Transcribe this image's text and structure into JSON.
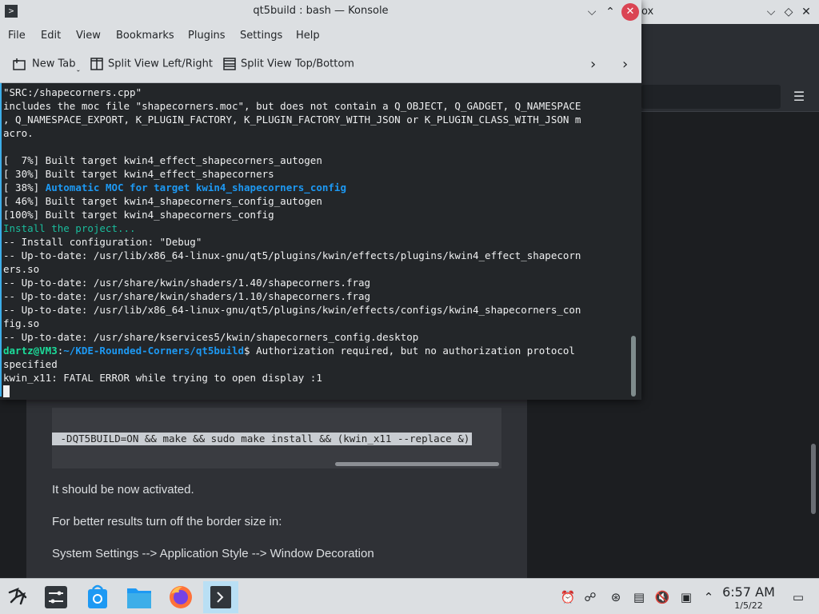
{
  "background_window": {
    "title_fragment": "ox",
    "code_line": " -DQT5BUILD=ON && make && sudo make install && (kwin_x11 --replace &)",
    "paragraphs": [
      "It should be now activated.",
      "For better results turn off the border size in:",
      "System Settings --> Application Style --> Window Decoration"
    ]
  },
  "konsole": {
    "title": "qt5build : bash — Konsole",
    "menu": [
      "File",
      "Edit",
      "View",
      "Bookmarks",
      "Plugins",
      "Settings",
      "Help"
    ],
    "toolbar": {
      "new_tab": "New Tab",
      "split_lr": "Split View Left/Right",
      "split_tb": "Split View Top/Bottom"
    },
    "terminal": {
      "l1": "\"SRC:/shapecorners.cpp\"",
      "l2": "includes the moc file \"shapecorners.moc\", but does not contain a Q_OBJECT, Q_GADGET, Q_NAMESPACE",
      "l3": ", Q_NAMESPACE_EXPORT, K_PLUGIN_FACTORY, K_PLUGIN_FACTORY_WITH_JSON or K_PLUGIN_CLASS_WITH_JSON m",
      "l4": "acro.",
      "l5": "",
      "l6": "[  7%] Built target kwin4_effect_shapecorners_autogen",
      "l7": "[ 30%] Built target kwin4_effect_shapecorners",
      "l8_prefix": "[ 38%] ",
      "l8_colored": "Automatic MOC for target kwin4_shapecorners_config",
      "l9": "[ 46%] Built target kwin4_shapecorners_config_autogen",
      "l10": "[100%] Built target kwin4_shapecorners_config",
      "l11": "Install the project...",
      "l12": "-- Install configuration: \"Debug\"",
      "l13": "-- Up-to-date: /usr/lib/x86_64-linux-gnu/qt5/plugins/kwin/effects/plugins/kwin4_effect_shapecorn",
      "l14": "ers.so",
      "l15": "-- Up-to-date: /usr/share/kwin/shaders/1.40/shapecorners.frag",
      "l16": "-- Up-to-date: /usr/share/kwin/shaders/1.10/shapecorners.frag",
      "l17": "-- Up-to-date: /usr/lib/x86_64-linux-gnu/qt5/plugins/kwin/effects/configs/kwin4_shapecorners_con",
      "l18": "fig.so",
      "l19": "-- Up-to-date: /usr/share/kservices5/kwin/shapecorners_config.desktop",
      "prompt_user": "dartz@VM3",
      "prompt_colon": ":",
      "prompt_path": "~/KDE-Rounded-Corners/qt5build",
      "prompt_rest": "$ Authorization required, but no authorization protocol",
      "l21": "specified",
      "l22": "kwin_x11: FATAL ERROR while trying to open display :1"
    }
  },
  "taskbar": {
    "time": "6:57 AM",
    "date": "1/5/22"
  }
}
